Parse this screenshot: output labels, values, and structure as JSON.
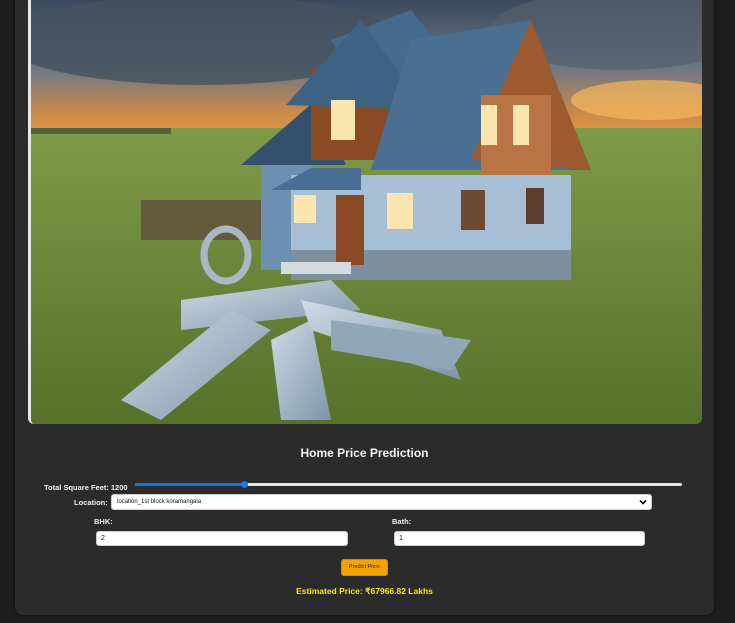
{
  "form": {
    "title": "Home Price Prediction",
    "sqft_label": "Total Square Feet:",
    "sqft_value": "1200",
    "sqft_slider_fraction": 0.2,
    "location_label": "Location:",
    "location_selected": "location_1st block koramangala",
    "bhk_label": "BHK:",
    "bhk_value": "2",
    "bath_label": "Bath:",
    "bath_value": "1",
    "predict_label": "Predict Price",
    "result_text": "Estimated Price: ₹67966.82 Lakhs"
  },
  "colors": {
    "accent": "#1a73e8",
    "button": "#f5a300",
    "result": "#ffe600",
    "panel": "#2b2b2b"
  },
  "icons": {
    "dropdown": "chevron-down-icon"
  }
}
